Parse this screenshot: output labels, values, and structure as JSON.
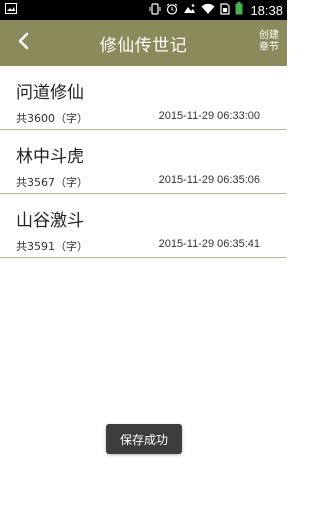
{
  "status_bar": {
    "time": "18:38",
    "icons": [
      "image-icon",
      "vibrate-icon",
      "alarm-icon",
      "photo-icon",
      "wifi-icon",
      "sim-icon",
      "battery-icon"
    ]
  },
  "header": {
    "title": "修仙传世记",
    "back_icon": "chevron-left-icon",
    "create_label_line1": "创建",
    "create_label_line2": "章节",
    "background": "#8b8a5b"
  },
  "chapters": [
    {
      "title": "问道修仙",
      "count": "共3600（字）",
      "time": "2015-11-29 06:33:00"
    },
    {
      "title": "林中斗虎",
      "count": "共3567（字）",
      "time": "2015-11-29 06:35:06"
    },
    {
      "title": "山谷激斗",
      "count": "共3591（字）",
      "time": "2015-11-29 06:35:41"
    }
  ],
  "toast": {
    "message": "保存成功"
  }
}
